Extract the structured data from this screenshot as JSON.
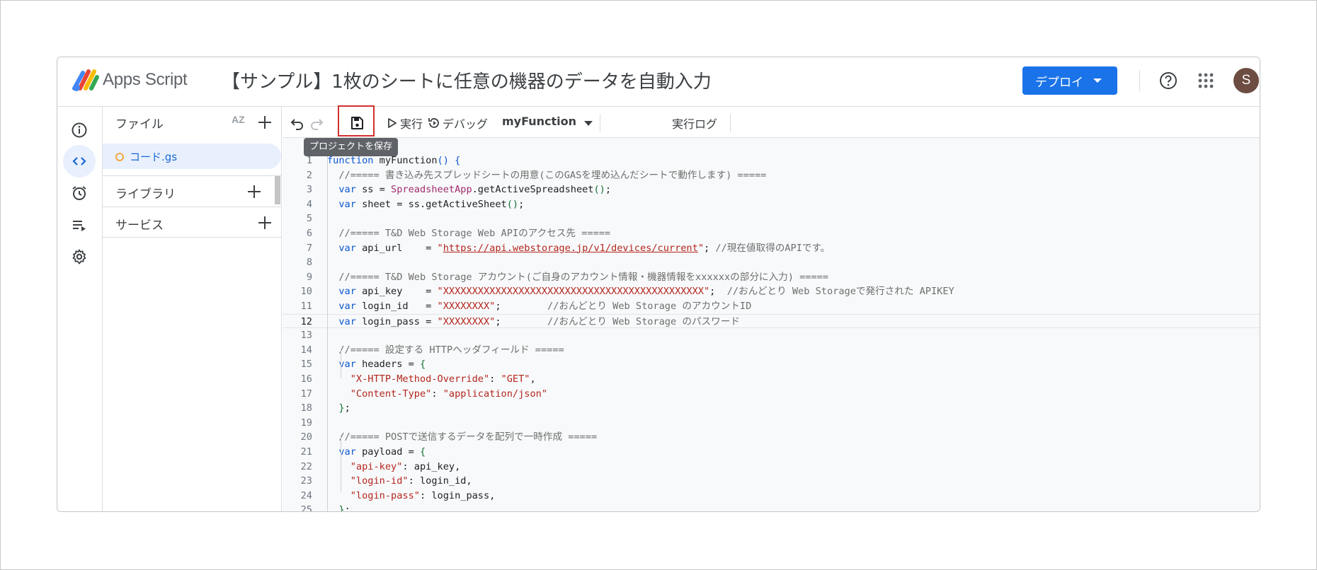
{
  "header": {
    "app_name": "Apps Script",
    "project_title": "【サンプル】1枚のシートに任意の機器のデータを自動入力",
    "deploy_label": "デプロイ",
    "avatar_initial": "S"
  },
  "colors": {
    "accent": "#1a73e8",
    "highlight_box": "#d32f2f",
    "avatar_bg": "#6d4c41"
  },
  "rail": {
    "icons": [
      "info-icon",
      "code-icon",
      "alarm-icon",
      "executions-icon",
      "settings-icon"
    ],
    "active": "code-icon"
  },
  "files": {
    "title": "ファイル",
    "sort_label": "AZ",
    "items": [
      {
        "name": "コード.gs",
        "selected": true
      }
    ],
    "libraries_label": "ライブラリ",
    "services_label": "サービス"
  },
  "toolbar": {
    "run_label": "実行",
    "debug_label": "デバッグ",
    "function_name": "myFunction",
    "log_label": "実行ログ",
    "tooltip": "プロジェクトを保存"
  },
  "editor": {
    "current_line": 12,
    "lines": [
      {
        "n": "1",
        "html": "<span class=\"kw\">function</span> myFunction<span class=\"kw\">()</span> <span class=\"kw\">{</span>"
      },
      {
        "n": "2",
        "html": "  <span class=\"cm\">//===== 書き込み先スプレッドシートの用意(このGASを埋め込んだシートで動作します) =====</span>"
      },
      {
        "n": "3",
        "html": "  <span class=\"kw\">var</span> ss = <span class=\"cls\">SpreadsheetApp</span>.getActiveSpreadsheet<span class=\"pn\">()</span>;"
      },
      {
        "n": "4",
        "html": "  <span class=\"kw\">var</span> sheet = ss.getActiveSheet<span class=\"pn\">()</span>;"
      },
      {
        "n": "5",
        "html": ""
      },
      {
        "n": "6",
        "html": "  <span class=\"cm\">//===== T&amp;D Web Storage Web APIのアクセス先 =====</span>"
      },
      {
        "n": "7",
        "html": "  <span class=\"kw\">var</span> api_url    = <span class=\"st\">\"</span><span class=\"url\">https://api.webstorage.jp/v1/devices/current</span><span class=\"st\">\"</span>; <span class=\"cm\">//現在値取得のAPIです。</span>"
      },
      {
        "n": "8",
        "html": ""
      },
      {
        "n": "9",
        "html": "  <span class=\"cm\">//===== T&amp;D Web Storage アカウント(ご自身のアカウント情報・機器情報をxxxxxxの部分に入力) =====</span>"
      },
      {
        "n": "10",
        "html": "  <span class=\"kw\">var</span> api_key    = <span class=\"st\">\"XXXXXXXXXXXXXXXXXXXXXXXXXXXXXXXXXXXXXXXXXXXXX\"</span>;  <span class=\"cm\">//おんどとり Web Storageで発行された APIKEY</span>"
      },
      {
        "n": "11",
        "html": "  <span class=\"kw\">var</span> login_id   = <span class=\"st\">\"XXXXXXXX\"</span>;        <span class=\"cm\">//おんどとり Web Storage のアカウントID</span>"
      },
      {
        "n": "12",
        "html": "  <span class=\"kw\">var</span> login_pass = <span class=\"st\">\"XXXXXXXX\"</span>;        <span class=\"cm\">//おんどとり Web Storage のパスワード</span>"
      },
      {
        "n": "13",
        "html": ""
      },
      {
        "n": "14",
        "html": "  <span class=\"cm\">//===== 設定する HTTPヘッダフィールド =====</span>"
      },
      {
        "n": "15",
        "html": "  <span class=\"kw\">var</span> headers = <span class=\"pn\">{</span>"
      },
      {
        "n": "16",
        "html": "    <span class=\"st\">\"X-HTTP-Method-Override\"</span>: <span class=\"st\">\"GET\"</span>,"
      },
      {
        "n": "17",
        "html": "    <span class=\"st\">\"Content-Type\"</span>: <span class=\"st\">\"application/json\"</span>"
      },
      {
        "n": "18",
        "html": "  <span class=\"pn\">}</span>;"
      },
      {
        "n": "19",
        "html": ""
      },
      {
        "n": "20",
        "html": "  <span class=\"cm\">//===== POSTで送信するデータを配列で一時作成 =====</span>"
      },
      {
        "n": "21",
        "html": "  <span class=\"kw\">var</span> payload = <span class=\"pn\">{</span>"
      },
      {
        "n": "22",
        "html": "    <span class=\"st\">\"api-key\"</span>: api_key,"
      },
      {
        "n": "23",
        "html": "    <span class=\"st\">\"login-id\"</span>: login_id,"
      },
      {
        "n": "24",
        "html": "    <span class=\"st\">\"login-pass\"</span>: login_pass,"
      },
      {
        "n": "25",
        "html": "  <span class=\"pn\">}</span>;"
      }
    ]
  }
}
